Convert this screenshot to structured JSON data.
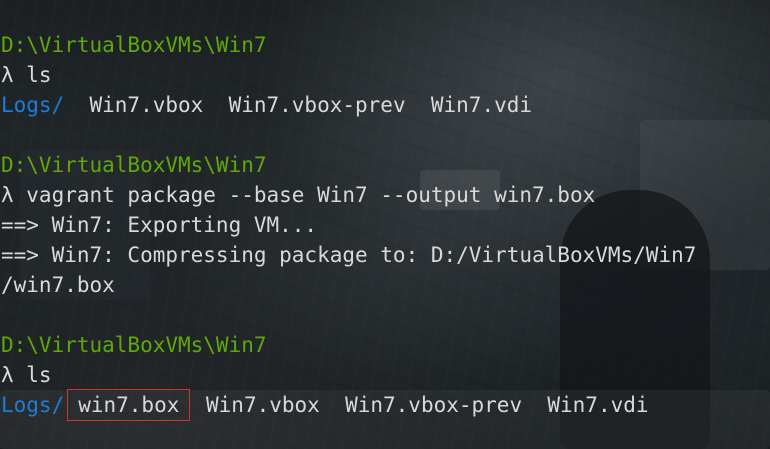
{
  "terminal": {
    "block1": {
      "prompt_path": "D:\\VirtualBoxVMs\\Win7",
      "command": "λ ls",
      "output_dir": "Logs/",
      "output_files": "  Win7.vbox  Win7.vbox-prev  Win7.vdi"
    },
    "block2": {
      "prompt_path": "D:\\VirtualBoxVMs\\Win7",
      "command": "λ vagrant package --base Win7 --output win7.box",
      "output_line1": "==> Win7: Exporting VM...",
      "output_line2": "==> Win7: Compressing package to: D:/VirtualBoxVMs/Win7",
      "output_line3": "/win7.box"
    },
    "block3": {
      "prompt_path": "D:\\VirtualBoxVMs\\Win7",
      "command": "λ ls",
      "output_dir": "Logs/",
      "highlighted_file": "win7.box",
      "output_files": " Win7.vbox  Win7.vbox-prev  Win7.vdi"
    }
  },
  "colors": {
    "path": "#5fa80a",
    "directory": "#1c7ed6",
    "text": "#d9d9d9",
    "highlight_box": "#d0342c"
  }
}
